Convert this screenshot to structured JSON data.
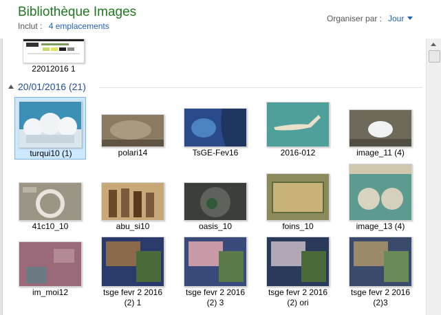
{
  "header": {
    "title": "Bibliothèque Images",
    "includes_label": "Inclut :",
    "includes_link": "4 emplacements",
    "arrange_label": "Organiser par :",
    "arrange_value": "Jour"
  },
  "colors": {
    "title": "#1e7a1e",
    "link": "#1f5fb8",
    "group": "#1f4e9a",
    "selection": "#cce8ff"
  },
  "previous_item": {
    "label": "22012016 1"
  },
  "group": {
    "label": "20/01/2016 (21)"
  },
  "items": [
    {
      "label": "turqui10 (1)",
      "selected": true
    },
    {
      "label": "polari14"
    },
    {
      "label": "TsGE-Fev16"
    },
    {
      "label": "2016-012"
    },
    {
      "label": "image_11 (4)"
    },
    {
      "label": "41c10_10"
    },
    {
      "label": "abu_si10"
    },
    {
      "label": "oasis_10"
    },
    {
      "label": "foins_10"
    },
    {
      "label": "image_13 (4)"
    },
    {
      "label": "im_moi12"
    },
    {
      "label": "tsge fevr 2 2016 (2) 1"
    },
    {
      "label": "tsge fevr 2 2016 (2) 3"
    },
    {
      "label": "tsge fevr 2 2016 (2) ori"
    },
    {
      "label": "tsge fevr 2 2016 (2)3"
    }
  ]
}
